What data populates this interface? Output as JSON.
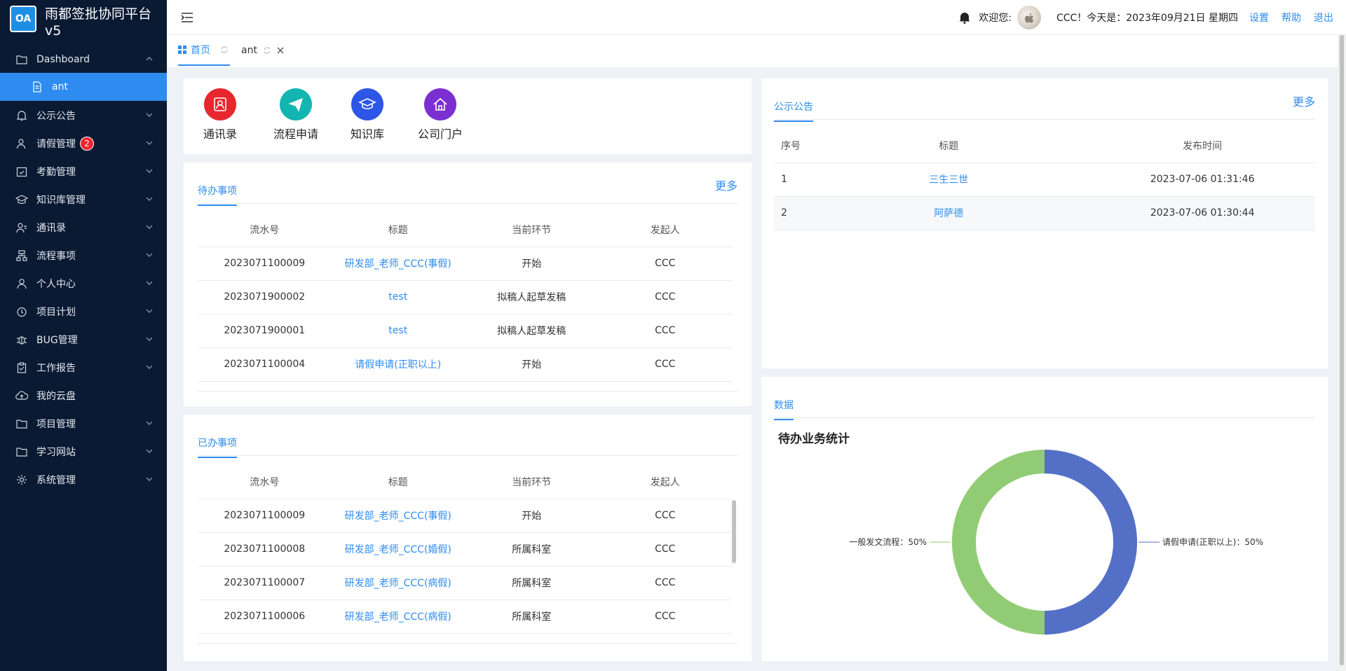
{
  "app": {
    "logo_text": "OA",
    "title": "雨都签批协同平台v5"
  },
  "sidebar": {
    "items": [
      {
        "label": "Dashboard",
        "icon": "folder-icon",
        "expanded": true
      },
      {
        "label": "ant",
        "icon": "file-icon",
        "active": true
      },
      {
        "label": "公示公告",
        "icon": "bell-icon"
      },
      {
        "label": "请假管理",
        "icon": "user-leave-icon",
        "badge": "2"
      },
      {
        "label": "考勤管理",
        "icon": "calendar-check-icon"
      },
      {
        "label": "知识库管理",
        "icon": "graduation-cap-icon"
      },
      {
        "label": "通讯录",
        "icon": "contacts-icon"
      },
      {
        "label": "流程事项",
        "icon": "flow-icon"
      },
      {
        "label": "个人中心",
        "icon": "user-icon"
      },
      {
        "label": "项目计划",
        "icon": "clock-icon"
      },
      {
        "label": "BUG管理",
        "icon": "bug-icon"
      },
      {
        "label": "工作报告",
        "icon": "clipboard-icon"
      },
      {
        "label": "我的云盘",
        "icon": "cloud-upload-icon"
      },
      {
        "label": "项目管理",
        "icon": "folder-icon"
      },
      {
        "label": "学习网站",
        "icon": "folder-icon"
      },
      {
        "label": "系统管理",
        "icon": "gear-icon"
      }
    ]
  },
  "header": {
    "welcome": "欢迎您:",
    "user_text": "CCC！今天是：2023年09月21日 星期四",
    "settings": "设置",
    "help": "帮助",
    "logout": "退出"
  },
  "tabs": [
    {
      "label": "首页",
      "active": true
    },
    {
      "label": "ant",
      "active": false
    }
  ],
  "quick_links": [
    {
      "label": "通讯录",
      "color": "#e8262d",
      "icon": "contacts-icon"
    },
    {
      "label": "流程申请",
      "color": "#13b5b1",
      "icon": "paper-plane-icon"
    },
    {
      "label": "知识库",
      "color": "#2e56e6",
      "icon": "graduation-cap-icon"
    },
    {
      "label": "公司门户",
      "color": "#7b2fd1",
      "icon": "home-icon"
    }
  ],
  "todo": {
    "title": "待办事项",
    "more": "更多",
    "columns": [
      "流水号",
      "标题",
      "当前环节",
      "发起人"
    ],
    "rows": [
      [
        "2023071100009",
        "研发部_老师_CCC(事假)",
        "开始",
        "CCC"
      ],
      [
        "2023071900002",
        "test",
        "拟稿人起草发稿",
        "CCC"
      ],
      [
        "2023071900001",
        "test",
        "拟稿人起草发稿",
        "CCC"
      ],
      [
        "2023071100004",
        "请假申请(正职以上)",
        "开始",
        "CCC"
      ]
    ]
  },
  "done": {
    "title": "已办事项",
    "columns": [
      "流水号",
      "标题",
      "当前环节",
      "发起人"
    ],
    "rows": [
      [
        "2023071100009",
        "研发部_老师_CCC(事假)",
        "开始",
        "CCC"
      ],
      [
        "2023071100008",
        "研发部_老师_CCC(婚假)",
        "所属科室",
        "CCC"
      ],
      [
        "2023071100007",
        "研发部_老师_CCC(病假)",
        "所属科室",
        "CCC"
      ],
      [
        "2023071100006",
        "研发部_老师_CCC(病假)",
        "所属科室",
        "CCC"
      ]
    ]
  },
  "notices": {
    "title": "公示公告",
    "more": "更多",
    "columns": [
      "序号",
      "标题",
      "发布时间"
    ],
    "rows": [
      [
        "1",
        "三生三世",
        "2023-07-06 01:31:46"
      ],
      [
        "2",
        "阿萨德",
        "2023-07-06 01:30:44"
      ]
    ]
  },
  "data_panel": {
    "title": "数据",
    "chart_title": "待办业务统计"
  },
  "chart_data": {
    "type": "pie",
    "title": "待办业务统计",
    "donut": true,
    "slices": [
      {
        "name": "请假申请(正职以上)",
        "value": 50,
        "label": "请假申请(正职以上)：50%",
        "color": "#5470c6"
      },
      {
        "name": "一般发文流程",
        "value": 50,
        "label": "一般发文流程：50%",
        "color": "#91cc75"
      }
    ]
  }
}
